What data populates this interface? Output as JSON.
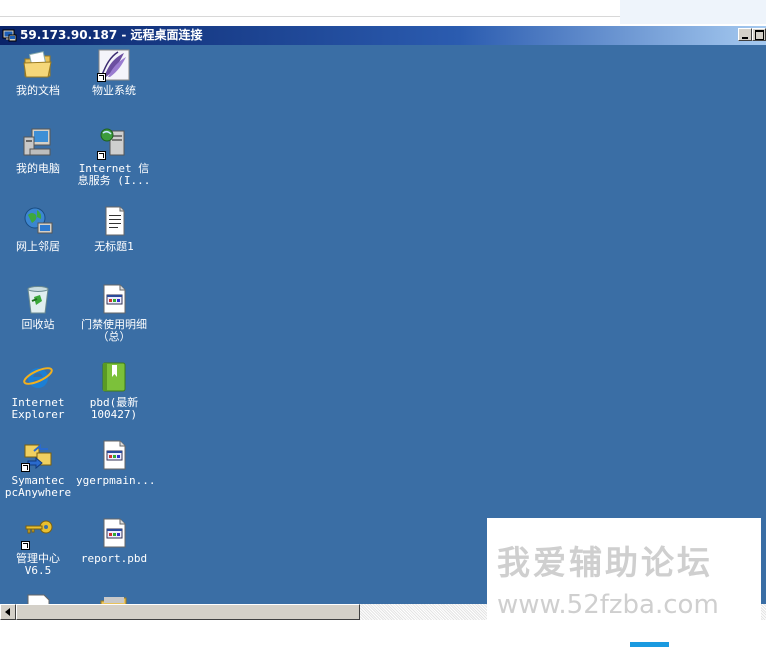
{
  "window": {
    "title": "59.173.90.187 - 远程桌面连接"
  },
  "desktop_icons": [
    {
      "label": "我的文档",
      "icon": "folder-documents-icon"
    },
    {
      "label": "物业系统",
      "icon": "app-feather-icon"
    },
    {
      "label": "我的电脑",
      "icon": "computer-icon"
    },
    {
      "label": "Internet 信\n息服务 (I...",
      "icon": "iis-icon"
    },
    {
      "label": "网上邻居",
      "icon": "network-icon"
    },
    {
      "label": "无标题1",
      "icon": "text-file-icon"
    },
    {
      "label": "回收站",
      "icon": "recycle-bin-icon"
    },
    {
      "label": "门禁使用明细\n（总）",
      "icon": "pbd-file-icon"
    },
    {
      "label": "Internet\nExplorer",
      "icon": "ie-icon"
    },
    {
      "label": "pbd(最新\n100427)",
      "icon": "green-book-icon"
    },
    {
      "label": "Symantec\npcAnywhere",
      "icon": "pcanywhere-icon"
    },
    {
      "label": "ygerpmain...",
      "icon": "pbd-file-icon"
    },
    {
      "label": "管理中心\nV6.5",
      "icon": "key-icon"
    },
    {
      "label": "report.pbd",
      "icon": "pbd-file-icon"
    }
  ],
  "watermark": {
    "cn": "我爱辅助论坛",
    "url": "www.52fzba.com"
  },
  "colors": {
    "desktop": "#3a6ea5",
    "titlebar": "#0a246a",
    "accent": "#1a9ae0"
  }
}
